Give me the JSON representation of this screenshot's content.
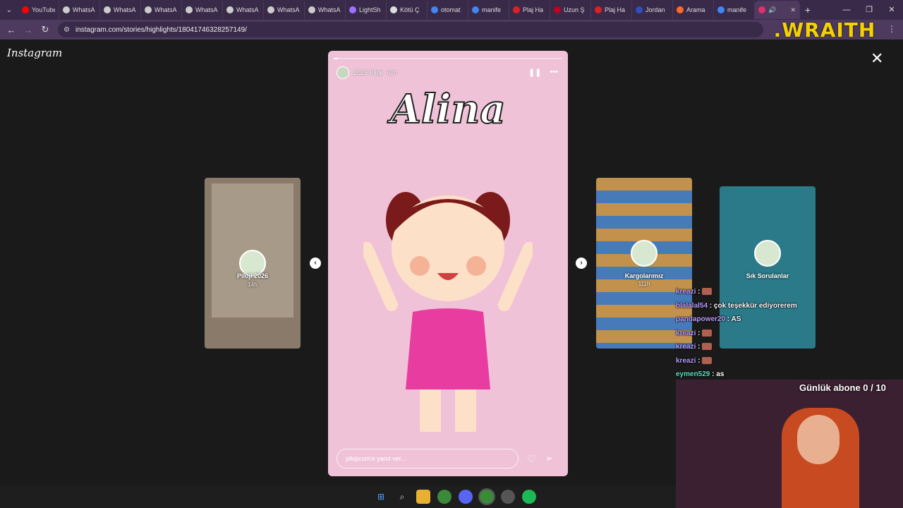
{
  "browser": {
    "tabs": [
      {
        "label": "YouTube",
        "color": "#ff0000"
      },
      {
        "label": "WhatsA",
        "color": "#cccccc"
      },
      {
        "label": "WhatsA",
        "color": "#cccccc"
      },
      {
        "label": "WhatsA",
        "color": "#cccccc"
      },
      {
        "label": "WhatsA",
        "color": "#cccccc"
      },
      {
        "label": "WhatsA",
        "color": "#cccccc"
      },
      {
        "label": "WhatsA",
        "color": "#cccccc"
      },
      {
        "label": "WhatsA",
        "color": "#cccccc"
      },
      {
        "label": "LightSh",
        "color": "#a070ff"
      },
      {
        "label": "Kötü Ç",
        "color": "#dddddd"
      },
      {
        "label": "otomat",
        "color": "#4285f4"
      },
      {
        "label": "manife",
        "color": "#4285f4"
      },
      {
        "label": "Plaj Ha",
        "color": "#e02020"
      },
      {
        "label": "Uzun Ş",
        "color": "#c00020"
      },
      {
        "label": "Plaj Ha",
        "color": "#e02020"
      },
      {
        "label": "Jordan",
        "color": "#3050c0"
      },
      {
        "label": "Arama",
        "color": "#ff6a20"
      },
      {
        "label": "manife",
        "color": "#4285f4"
      }
    ],
    "active_tab_color": "#e1306c",
    "url": "instagram.com/stories/highlights/18041746328257149/",
    "overlay_brand": ".WRAITH"
  },
  "instagram": {
    "logo": "Instagram",
    "stories": {
      "left": {
        "name": "Piloji 2026",
        "age": "14h"
      },
      "right1": {
        "name": "Kargolarımız",
        "age": "111h"
      },
      "right2": {
        "name": "Sık Sorulanlar",
        "age": ""
      }
    },
    "main": {
      "account": "2025 Piloji",
      "age": "62h",
      "artwork_text": "Alina",
      "reply_placeholder": "pilojicom'e yanıt ver...",
      "progress": 0.02
    }
  },
  "chat": [
    {
      "user": "kreazi",
      "color": "#b89cff",
      "text": "",
      "emote": true
    },
    {
      "user": "blalalal54",
      "color": "#b89cff",
      "text": "çok teşekkür ediyorerem",
      "emote": false
    },
    {
      "user": "pandapower20",
      "color": "#b89cff",
      "text": "AS",
      "emote": false
    },
    {
      "user": "kreazi",
      "color": "#b89cff",
      "text": "",
      "emote": true
    },
    {
      "user": "kreazi",
      "color": "#b89cff",
      "text": "",
      "emote": true
    },
    {
      "user": "kreazi",
      "color": "#b89cff",
      "text": "",
      "emote": true
    },
    {
      "user": "eymen529",
      "color": "#5ee0c0",
      "text": "as",
      "emote": false
    }
  ],
  "stream": {
    "sub_goal": "Günlük abone 0 / 10"
  }
}
